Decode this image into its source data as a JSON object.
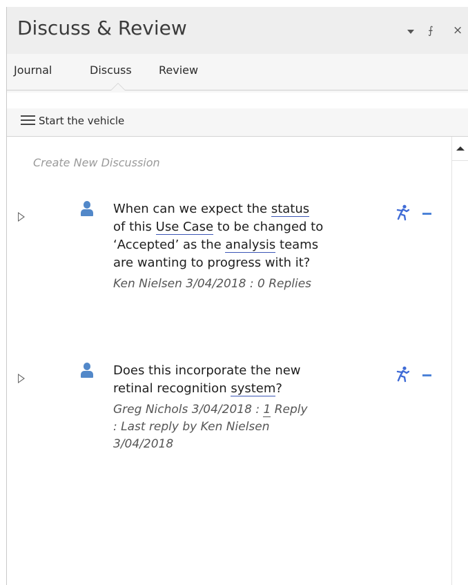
{
  "window": {
    "title": "Discuss & Review",
    "controls": {
      "dropdown": "dropdown-arrow-icon",
      "pin": "pin-icon",
      "close": "close-icon"
    },
    "pin_glyph": "⨍",
    "close_glyph": "×"
  },
  "tabs": [
    {
      "label": "Journal",
      "active": false
    },
    {
      "label": "Discuss",
      "active": true
    },
    {
      "label": "Review",
      "active": false
    }
  ],
  "context": {
    "menu_icon": "hamburger-menu-icon",
    "title": "Start the vehicle"
  },
  "create_new_placeholder": "Create New Discussion",
  "discussions": [
    {
      "message_lines": [
        [
          "When can we expect the ",
          {
            "link": "status"
          }
        ],
        [
          "of this ",
          {
            "link": "Use Case"
          },
          " to be changed to"
        ],
        [
          "‘Accepted’ as the ",
          {
            "link": "analysis"
          },
          " teams"
        ],
        [
          "are wanting to progress with it?"
        ]
      ],
      "author": "Ken Nielsen",
      "date": "3/04/2018",
      "separator": ":",
      "replies_count": "0",
      "replies_label": "Replies",
      "meta_lines": [
        "Ken Nielsen 3/04/2018 : 0 Replies"
      ],
      "status_icon": "running-man-icon",
      "collapse_icon": "minus-icon"
    },
    {
      "message_lines": [
        [
          "Does this incorporate the new"
        ],
        [
          "retinal recognition ",
          {
            "link": "system"
          },
          "?"
        ]
      ],
      "author": "Greg Nichols",
      "date": "3/04/2018",
      "separator": ":",
      "replies_count": "1",
      "replies_label": "Reply",
      "last_reply_label": "Last reply by",
      "last_reply_author": "Ken Nielsen",
      "last_reply_date": "3/04/2018",
      "meta_lines": [
        "Greg Nichols 3/04/2018 : 1 Reply",
        ":  Last reply by Ken Nielsen",
        "3/04/2018"
      ],
      "status_icon": "running-man-icon",
      "collapse_icon": "minus-icon"
    }
  ],
  "colors": {
    "accent": "#4d83d8",
    "avatar": "#5288c9",
    "link_underline": "#3a55b5"
  }
}
